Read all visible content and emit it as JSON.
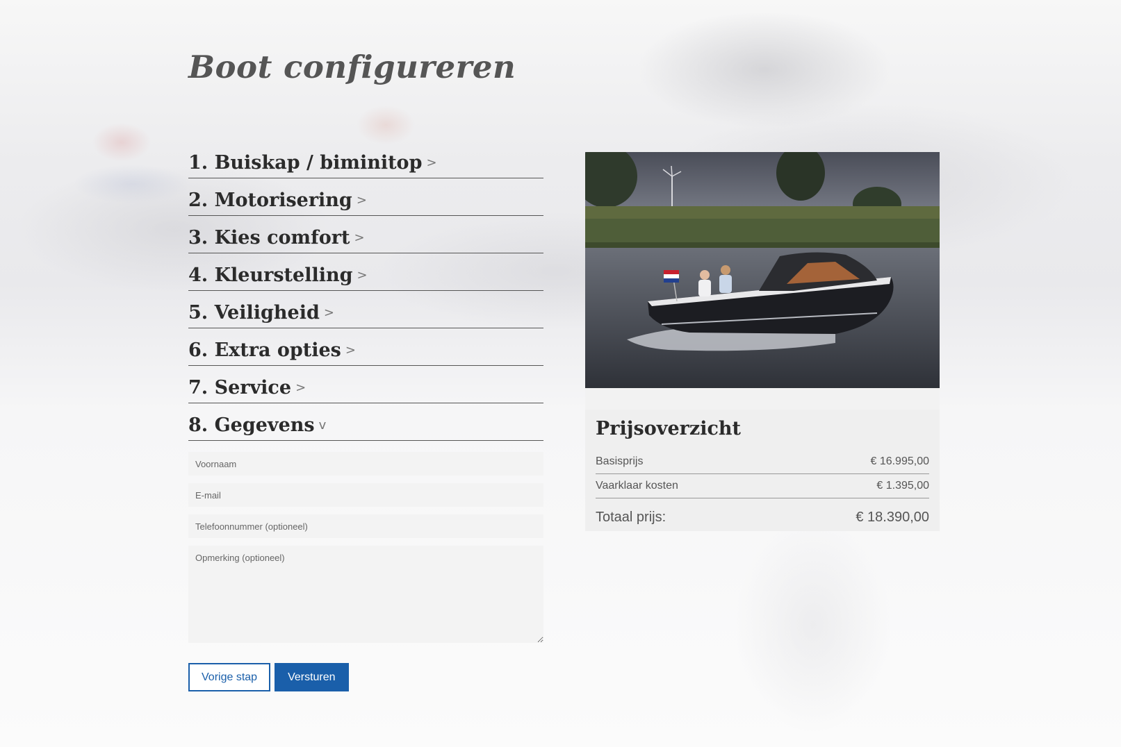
{
  "page": {
    "title": "Boot configureren"
  },
  "steps": [
    {
      "label": "1. Buiskap / biminitop",
      "chevron": ">"
    },
    {
      "label": "2. Motorisering",
      "chevron": ">"
    },
    {
      "label": "3. Kies comfort",
      "chevron": ">"
    },
    {
      "label": "4. Kleurstelling",
      "chevron": ">"
    },
    {
      "label": "5. Veiligheid",
      "chevron": ">"
    },
    {
      "label": "6. Extra opties",
      "chevron": ">"
    },
    {
      "label": "7. Service",
      "chevron": ">"
    },
    {
      "label": "8. Gegevens",
      "chevron": "v"
    }
  ],
  "form": {
    "first_name_placeholder": "Voornaam",
    "email_placeholder": "E-mail",
    "phone_placeholder": "Telefoonnummer (optioneel)",
    "remark_placeholder": "Opmerking (optioneel)"
  },
  "buttons": {
    "previous_label": "Vorige stap",
    "submit_label": "Versturen"
  },
  "price_overview": {
    "title": "Prijsoverzicht",
    "rows": [
      {
        "label": "Basisprijs",
        "value": "€ 16.995,00"
      },
      {
        "label": "Vaarklaar kosten",
        "value": "€ 1.395,00"
      }
    ],
    "total_label": "Totaal prijs:",
    "total_value": "€ 18.390,00"
  },
  "colors": {
    "accent": "#1a5faa",
    "heading": "#2b2b2b",
    "boat_hull": "#1c1d22",
    "flag_red": "#c8202e",
    "flag_blue": "#22408f"
  }
}
